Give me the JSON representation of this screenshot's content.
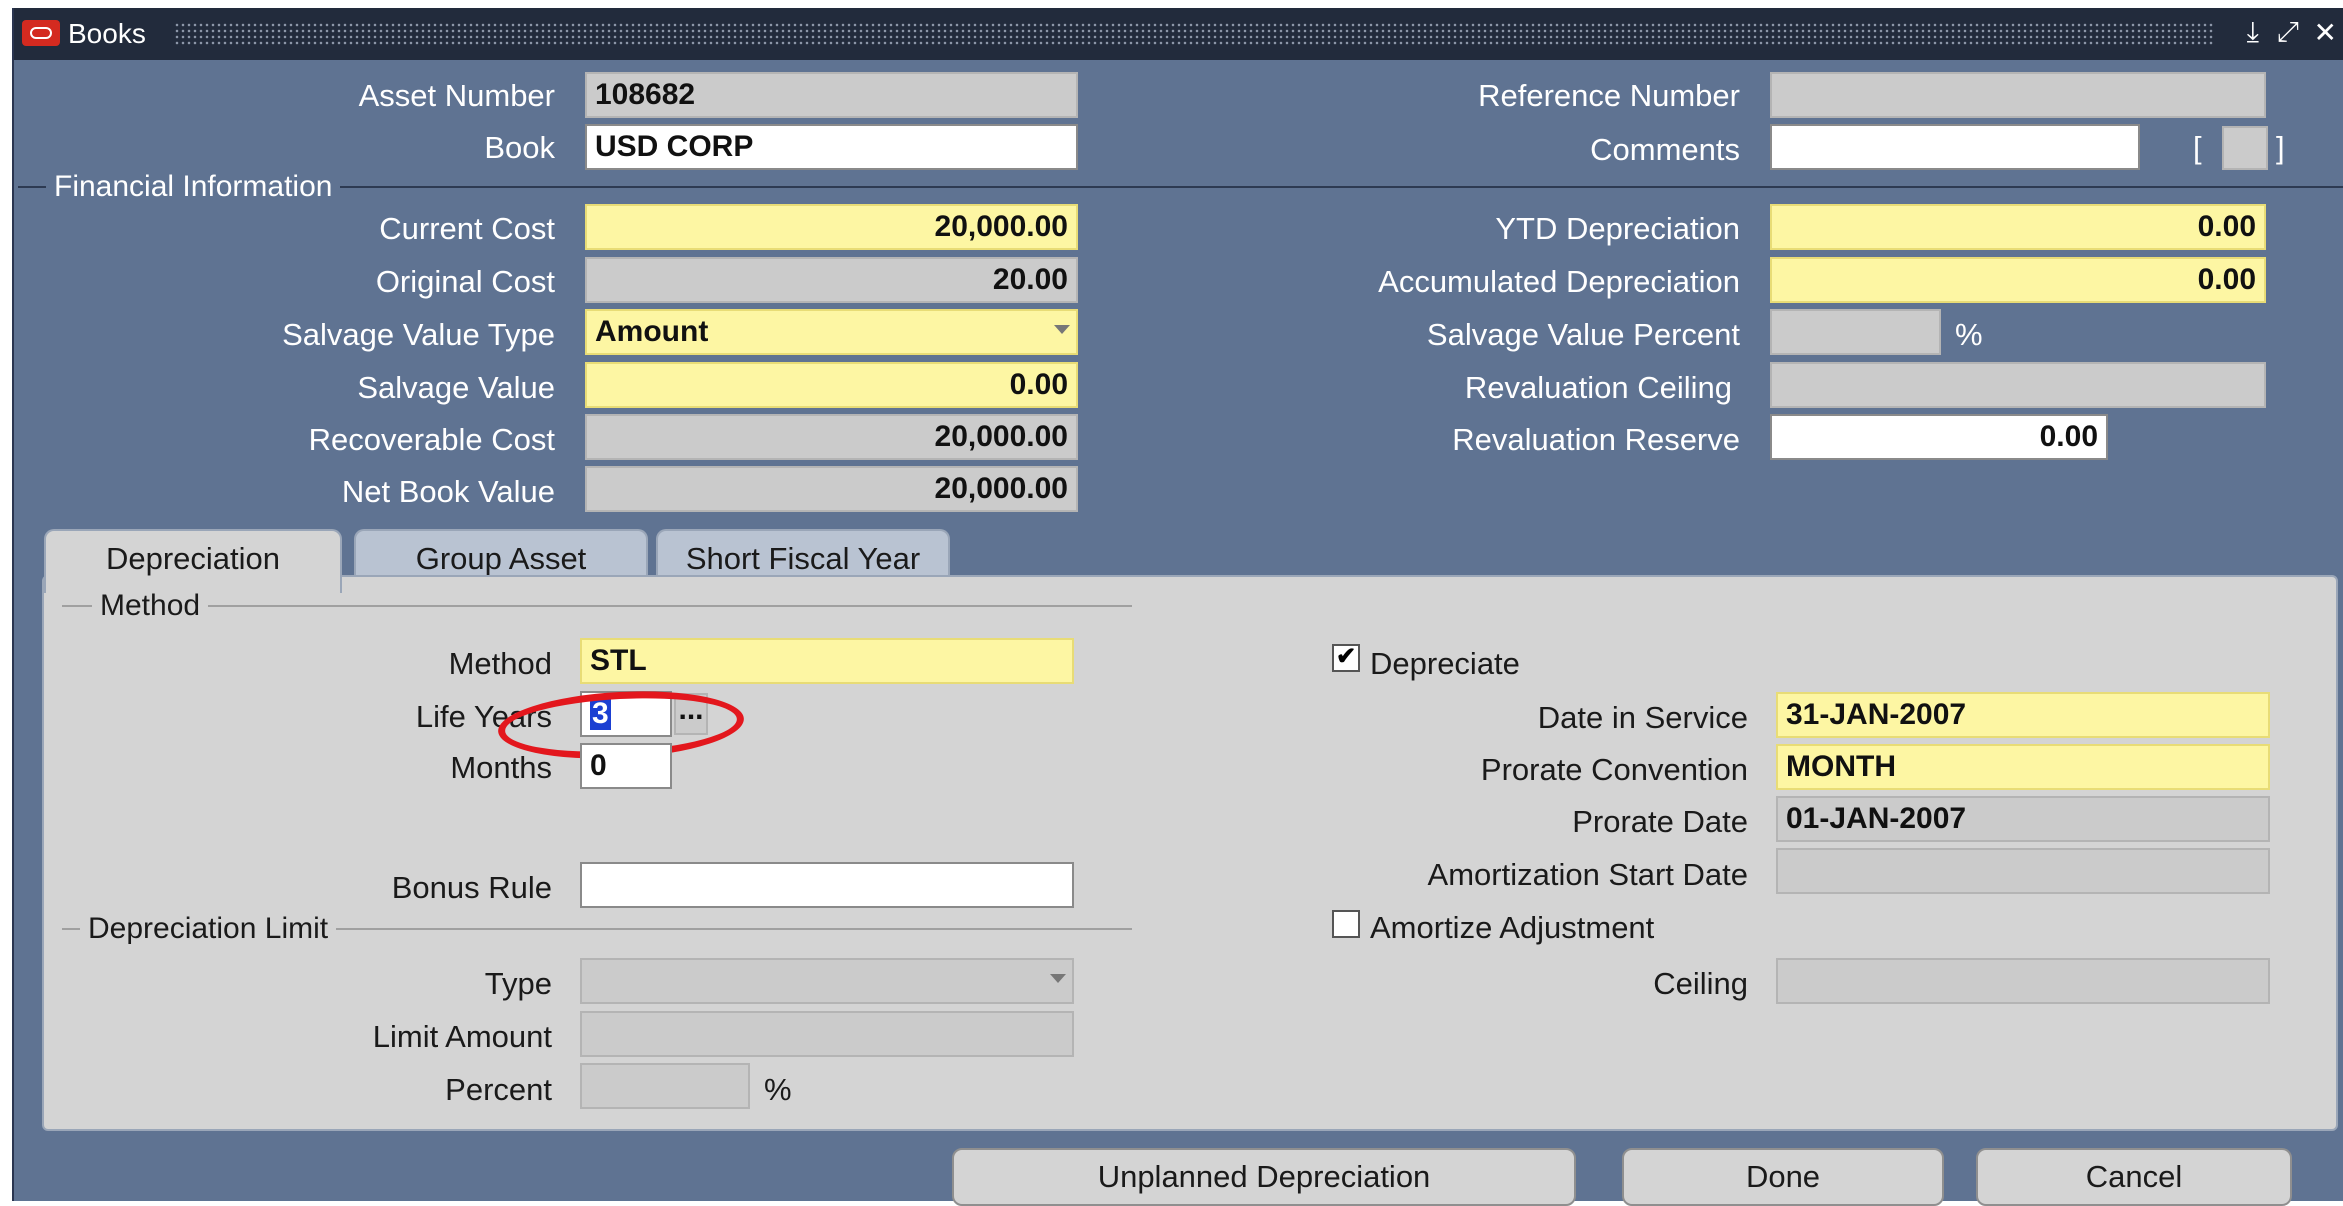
{
  "window": {
    "title": "Books",
    "minimize": "⤓",
    "maximize": "⤢",
    "close": "✕"
  },
  "header": {
    "asset_number_label": "Asset Number",
    "asset_number": "108682",
    "book_label": "Book",
    "book": "USD CORP",
    "reference_number_label": "Reference Number",
    "reference_number": "",
    "comments_label": "Comments",
    "comments": "",
    "bracket_left": "[",
    "bracket_right": "]"
  },
  "financial": {
    "section_label": "Financial Information",
    "current_cost_label": "Current Cost",
    "current_cost": "20,000.00",
    "original_cost_label": "Original Cost",
    "original_cost": "20.00",
    "salvage_value_type_label": "Salvage Value Type",
    "salvage_value_type": "Amount",
    "salvage_value_label": "Salvage Value",
    "salvage_value": "0.00",
    "recoverable_cost_label": "Recoverable Cost",
    "recoverable_cost": "20,000.00",
    "net_book_value_label": "Net Book Value",
    "net_book_value": "20,000.00",
    "ytd_depreciation_label": "YTD Depreciation",
    "ytd_depreciation": "0.00",
    "accumulated_depreciation_label": "Accumulated Depreciation",
    "accumulated_depreciation": "0.00",
    "salvage_value_percent_label": "Salvage Value Percent",
    "percent_sign": "%",
    "revaluation_ceiling_label": "Revaluation Ceiling",
    "revaluation_reserve_label": "Revaluation Reserve",
    "revaluation_reserve": "0.00"
  },
  "tabs": [
    {
      "label": "Depreciation",
      "active": true
    },
    {
      "label": "Group Asset",
      "active": false
    },
    {
      "label": "Short Fiscal Year",
      "active": false
    }
  ],
  "depreciation": {
    "method_section_label": "Method",
    "method_label": "Method",
    "method": "STL",
    "life_years_label": "Life Years",
    "life_years": "3",
    "life_years_lov": "...",
    "months_label": "Months",
    "months": "0",
    "bonus_rule_label": "Bonus Rule",
    "bonus_rule": "",
    "limit_section_label": "Depreciation Limit",
    "type_label": "Type",
    "limit_amount_label": "Limit Amount",
    "percent_label": "Percent",
    "percent_sign": "%",
    "depreciate_label": "Depreciate",
    "depreciate_checked": "✔",
    "date_in_service_label": "Date in Service",
    "date_in_service": "31-JAN-2007",
    "prorate_convention_label": "Prorate Convention",
    "prorate_convention": "MONTH",
    "prorate_date_label": "Prorate Date",
    "prorate_date": "01-JAN-2007",
    "amortization_start_date_label": "Amortization Start Date",
    "amortize_adjustment_label": "Amortize Adjustment",
    "ceiling_label": "Ceiling"
  },
  "buttons": {
    "unplanned": "Unplanned Depreciation",
    "done": "Done",
    "cancel": "Cancel"
  },
  "colors": {
    "window_bg": "#5f7392",
    "required_field": "#fdf6a3",
    "highlight_ring": "#e3171d"
  }
}
